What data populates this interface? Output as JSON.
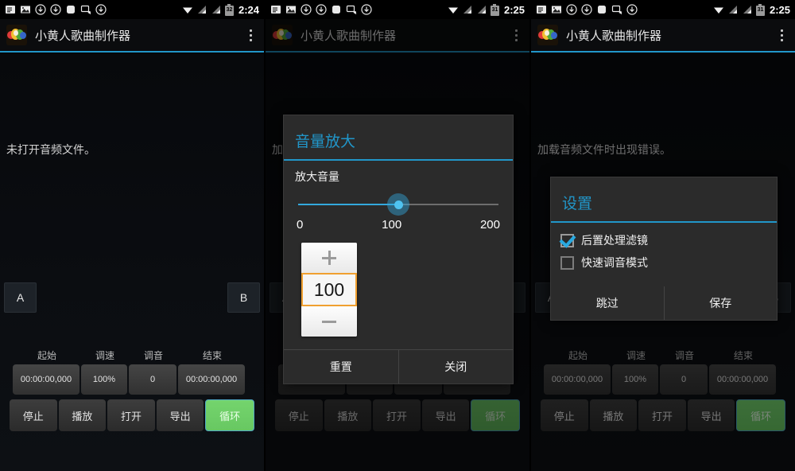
{
  "app": {
    "title": "小黄人歌曲制作器",
    "accent_color": "#2196c9",
    "loop_color": "#6cc866",
    "stepper_focus_color": "#f0a030"
  },
  "icons": {
    "overflow": "overflow-menu-icon",
    "app_logo": "app-logo-icon",
    "status_note": "note-icon",
    "status_image": "image-icon",
    "status_download_1": "download-icon",
    "status_download_2": "download-icon",
    "status_blank": "rounded-square-icon",
    "status_screencast": "screencast-off-icon",
    "status_download_3": "download-icon",
    "wifi": "wifi-icon",
    "signal_1": "signal-bars-icon",
    "signal_2": "signal-bars-icon",
    "battery": "battery-icon"
  },
  "panels": [
    {
      "id": "panel-1",
      "status_bar": {
        "time": "2:24",
        "battery_level": "32"
      },
      "canvas_message": "未打开音频文件。",
      "marker_a": "A",
      "marker_b": "B",
      "dimmed": false,
      "audio_tag": ""
    },
    {
      "id": "panel-2",
      "status_bar": {
        "time": "2:25",
        "battery_level": "31"
      },
      "canvas_message": "加载音频文件时出现错误。",
      "marker_a": "A",
      "marker_b": "B",
      "dimmed": true,
      "audio_tag": ""
    },
    {
      "id": "panel-3",
      "status_bar": {
        "time": "2:25",
        "battery_level": "31"
      },
      "canvas_message": "加载音频文件时出现错误。",
      "marker_a": "A",
      "marker_b": "B",
      "dimmed": true,
      "audio_tag": "audio:629407"
    }
  ],
  "controls": {
    "labels": [
      "起始",
      "调速",
      "调音",
      "结束"
    ],
    "values": [
      "00:00:00,000",
      "100%",
      "0",
      "00:00:00,000"
    ],
    "buttons": [
      "停止",
      "播放",
      "打开",
      "导出",
      "循环"
    ]
  },
  "volume_dialog": {
    "title": "音量放大",
    "subtitle": "放大音量",
    "slider": {
      "min": 0,
      "max": 200,
      "value": 100,
      "fill_percent": 50
    },
    "ticks": [
      "0",
      "100",
      "200"
    ],
    "stepper": {
      "value": "100",
      "increase": "+",
      "decrease": "−"
    },
    "actions": [
      "重置",
      "关闭"
    ]
  },
  "settings_dialog": {
    "title": "设置",
    "options": [
      {
        "label": "后置处理滤镜",
        "checked": true
      },
      {
        "label": "快速调音模式",
        "checked": false
      }
    ],
    "actions": [
      "跳过",
      "保存"
    ]
  }
}
